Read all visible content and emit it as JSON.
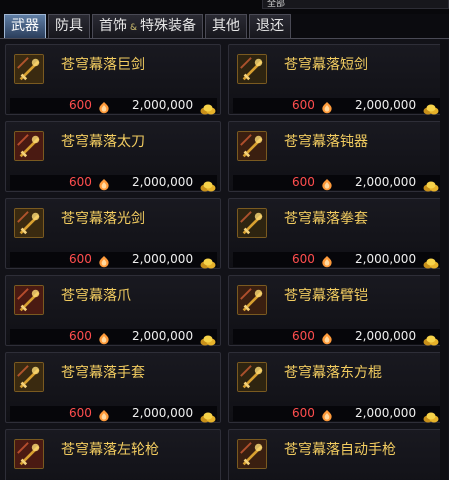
{
  "top_dropdown": {
    "value": "全部"
  },
  "tabs": [
    {
      "label": "武器",
      "active": true
    },
    {
      "label": "防具",
      "active": false
    },
    {
      "label": "首饰",
      "label2": "特殊装备",
      "separator": "&",
      "active": false
    },
    {
      "label": "其他",
      "active": false
    },
    {
      "label": "退还",
      "active": false
    }
  ],
  "items": [
    {
      "name": "苍穹幕落巨剑",
      "cera_price": "600",
      "gold_price": "2,000,000",
      "icon": "greatsword-icon"
    },
    {
      "name": "苍穹幕落短剑",
      "cera_price": "600",
      "gold_price": "2,000,000",
      "icon": "shortsword-icon"
    },
    {
      "name": "苍穹幕落太刀",
      "cera_price": "600",
      "gold_price": "2,000,000",
      "icon": "katana-icon"
    },
    {
      "name": "苍穹幕落钝器",
      "cera_price": "600",
      "gold_price": "2,000,000",
      "icon": "blunt-weapon-icon"
    },
    {
      "name": "苍穹幕落光剑",
      "cera_price": "600",
      "gold_price": "2,000,000",
      "icon": "lightsaber-icon"
    },
    {
      "name": "苍穹幕落拳套",
      "cera_price": "600",
      "gold_price": "2,000,000",
      "icon": "knuckle-icon"
    },
    {
      "name": "苍穹幕落爪",
      "cera_price": "600",
      "gold_price": "2,000,000",
      "icon": "claw-icon"
    },
    {
      "name": "苍穹幕落臂铠",
      "cera_price": "600",
      "gold_price": "2,000,000",
      "icon": "gauntlet-icon"
    },
    {
      "name": "苍穹幕落手套",
      "cera_price": "600",
      "gold_price": "2,000,000",
      "icon": "glove-icon"
    },
    {
      "name": "苍穹幕落东方棍",
      "cera_price": "600",
      "gold_price": "2,000,000",
      "icon": "tonfa-icon"
    },
    {
      "name": "苍穹幕落左轮枪",
      "cera_price": "",
      "gold_price": "",
      "icon": "revolver-icon"
    },
    {
      "name": "苍穹幕落自动手枪",
      "cera_price": "",
      "gold_price": "",
      "icon": "auto-pistol-icon"
    }
  ],
  "colors": {
    "item_name": "#f2cc60",
    "cera_price": "#ff4e4e",
    "gold_price": "#f0f0f0",
    "active_tab": "#5f7ea5"
  },
  "currency_icons": {
    "cera": "cera-point-icon",
    "gold": "gold-coin-icon"
  }
}
